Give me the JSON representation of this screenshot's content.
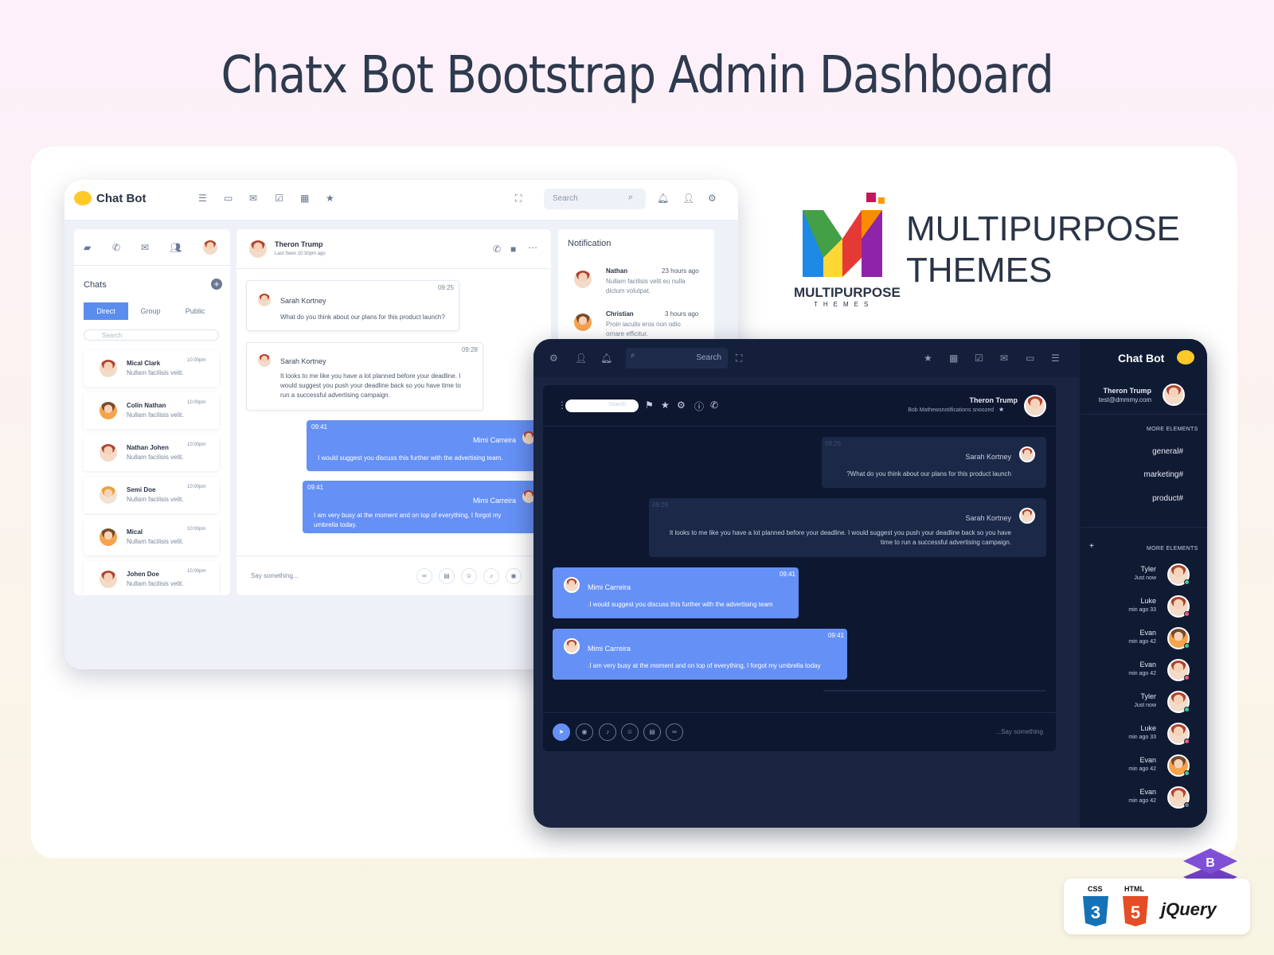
{
  "hero": {
    "title": "Chatx Bot Bootstrap Admin Dashboard"
  },
  "light": {
    "logo_text": "Chat Bot",
    "search_placeholder": "Search",
    "chats_title": "Chats",
    "segments": [
      "Direct",
      "Group",
      "Public"
    ],
    "chat_search_placeholder": "Search",
    "contacts": [
      {
        "name": "Mical Clark",
        "msg": "Nullam facilisis velit.",
        "time": "10:00pm"
      },
      {
        "name": "Colin Nathan",
        "msg": "Nullam facilisis velit.",
        "time": "10:00pm"
      },
      {
        "name": "Nathan Johen",
        "msg": "Nullam facilisis velit.",
        "time": "10:00pm"
      },
      {
        "name": "Semi Doe",
        "msg": "Nullam facilisis velit.",
        "time": "10:00pm"
      },
      {
        "name": "Mical",
        "msg": "Nullam facilisis velit.",
        "time": "10:00pm"
      },
      {
        "name": "Johen Doe",
        "msg": "Nullam facilisis velit.",
        "time": "10:00pm"
      }
    ],
    "chat_header": {
      "name": "Theron Trump",
      "status": "Last Seen 10:30pm ago"
    },
    "messages": [
      {
        "who": "Sarah Kortney",
        "time": "09:25",
        "text": "What do you think about our plans for this product launch?"
      },
      {
        "who": "Sarah Kortney",
        "time": "09:28",
        "text": "It looks to me like you have a lot planned before your deadline. I would suggest you push your deadline back so you have time to run a successful advertising campaign."
      },
      {
        "who": "Mimi Carreira",
        "time": "09:41",
        "text": "I would suggest you discuss this further with the advertising team."
      },
      {
        "who": "Mimi Carreira",
        "time": "09:41",
        "text": "I am very busy at the moment and on top of everything, I forgot my umbrella today."
      }
    ],
    "input_placeholder": "Say something...",
    "notification": {
      "title": "Notification",
      "items": [
        {
          "name": "Nathan",
          "time": "23 hours ago",
          "text": "Nullam facilisis velit eu nulla dictum volutpat."
        },
        {
          "name": "Christian",
          "time": "3 hours ago",
          "text": "Proin iaculis eros non odio ornare efficitur."
        }
      ]
    }
  },
  "dark": {
    "search_placeholder": "Search",
    "logo_text": "Chat Bot",
    "user": {
      "name": "Theron Trump",
      "email": "test@dmmmy.com"
    },
    "section_more": "MORE ELEMENTS",
    "tags": [
      "general#",
      "marketing#",
      "product#"
    ],
    "online": [
      {
        "name": "Tyler",
        "status": "Just now",
        "dot": "#3ecf8e"
      },
      {
        "name": "Luke",
        "status": "min ago 33",
        "dot": "#f25c78"
      },
      {
        "name": "Evan",
        "status": "min ago 42",
        "dot": "#3ecf8e"
      },
      {
        "name": "Evan",
        "status": "min ago 42",
        "dot": "#f25c78"
      },
      {
        "name": "Tyler",
        "status": "Just now",
        "dot": "#3ecf8e"
      },
      {
        "name": "Luke",
        "status": "min ago 33",
        "dot": "#f25c78"
      },
      {
        "name": "Evan",
        "status": "min ago 42",
        "dot": "#3ecf8e"
      },
      {
        "name": "Evan",
        "status": "min ago 42",
        "dot": "#6b7a93"
      }
    ],
    "panel_search_placeholder": "Search",
    "chat_header": {
      "name": "Theron Trump",
      "status": "Bob Mathewsnotifications snoozed"
    },
    "messages": [
      {
        "who": "Sarah Kortney",
        "time": "09:25",
        "text": "?What do you think about our plans for this product launch"
      },
      {
        "who": "Sarah Kortney",
        "time": "09:28",
        "text": "It looks to me like you have a lot planned before your deadline. I would suggest you push your deadline back so you have time to run a successful advertising campaign."
      },
      {
        "who": "Mimi Carreira",
        "time": "09:41",
        "text": ".I would suggest you discuss this further with the advertising team"
      },
      {
        "who": "Mimi Carreira",
        "time": "09:41",
        "text": ".I am very busy at the moment and on top of everything, I forgot my umbrella today"
      }
    ],
    "input_placeholder": "...Say something"
  },
  "brand": {
    "wordmark": "MULTIPURPOSE",
    "sub": "THEMES",
    "title_line1": "MULTIPURPOSE",
    "title_line2": "THEMES"
  },
  "tech": {
    "css": "CSS",
    "html": "HTML",
    "jquery": "jQuery"
  },
  "colors": {
    "accent": "#6590f5",
    "dark_bg": "#1a2542",
    "light_bg": "#eef1f8"
  }
}
